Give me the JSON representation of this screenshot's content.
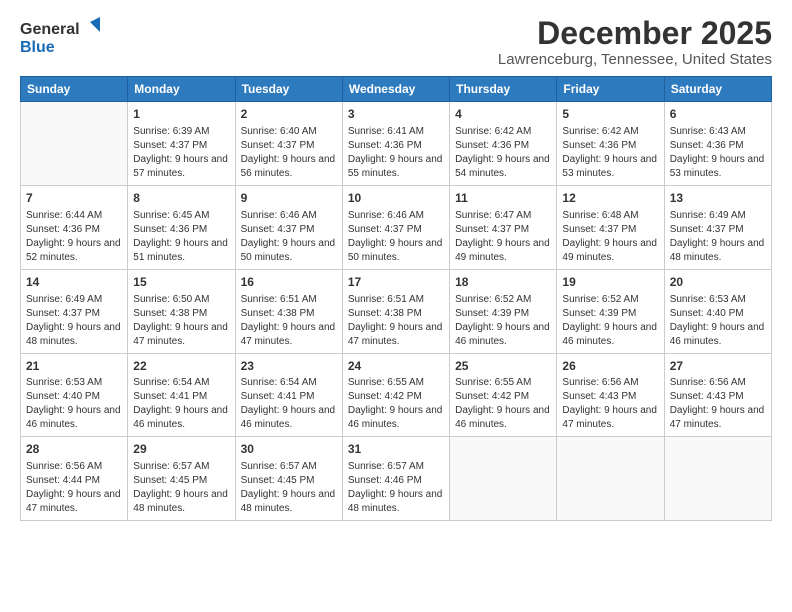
{
  "header": {
    "logo_general": "General",
    "logo_blue": "Blue",
    "month": "December 2025",
    "location": "Lawrenceburg, Tennessee, United States"
  },
  "weekdays": [
    "Sunday",
    "Monday",
    "Tuesday",
    "Wednesday",
    "Thursday",
    "Friday",
    "Saturday"
  ],
  "weeks": [
    [
      {
        "day": "",
        "sunrise": "",
        "sunset": "",
        "daylight": "",
        "empty": true
      },
      {
        "day": "1",
        "sunrise": "Sunrise: 6:39 AM",
        "sunset": "Sunset: 4:37 PM",
        "daylight": "Daylight: 9 hours and 57 minutes."
      },
      {
        "day": "2",
        "sunrise": "Sunrise: 6:40 AM",
        "sunset": "Sunset: 4:37 PM",
        "daylight": "Daylight: 9 hours and 56 minutes."
      },
      {
        "day": "3",
        "sunrise": "Sunrise: 6:41 AM",
        "sunset": "Sunset: 4:36 PM",
        "daylight": "Daylight: 9 hours and 55 minutes."
      },
      {
        "day": "4",
        "sunrise": "Sunrise: 6:42 AM",
        "sunset": "Sunset: 4:36 PM",
        "daylight": "Daylight: 9 hours and 54 minutes."
      },
      {
        "day": "5",
        "sunrise": "Sunrise: 6:42 AM",
        "sunset": "Sunset: 4:36 PM",
        "daylight": "Daylight: 9 hours and 53 minutes."
      },
      {
        "day": "6",
        "sunrise": "Sunrise: 6:43 AM",
        "sunset": "Sunset: 4:36 PM",
        "daylight": "Daylight: 9 hours and 53 minutes."
      }
    ],
    [
      {
        "day": "7",
        "sunrise": "Sunrise: 6:44 AM",
        "sunset": "Sunset: 4:36 PM",
        "daylight": "Daylight: 9 hours and 52 minutes."
      },
      {
        "day": "8",
        "sunrise": "Sunrise: 6:45 AM",
        "sunset": "Sunset: 4:36 PM",
        "daylight": "Daylight: 9 hours and 51 minutes."
      },
      {
        "day": "9",
        "sunrise": "Sunrise: 6:46 AM",
        "sunset": "Sunset: 4:37 PM",
        "daylight": "Daylight: 9 hours and 50 minutes."
      },
      {
        "day": "10",
        "sunrise": "Sunrise: 6:46 AM",
        "sunset": "Sunset: 4:37 PM",
        "daylight": "Daylight: 9 hours and 50 minutes."
      },
      {
        "day": "11",
        "sunrise": "Sunrise: 6:47 AM",
        "sunset": "Sunset: 4:37 PM",
        "daylight": "Daylight: 9 hours and 49 minutes."
      },
      {
        "day": "12",
        "sunrise": "Sunrise: 6:48 AM",
        "sunset": "Sunset: 4:37 PM",
        "daylight": "Daylight: 9 hours and 49 minutes."
      },
      {
        "day": "13",
        "sunrise": "Sunrise: 6:49 AM",
        "sunset": "Sunset: 4:37 PM",
        "daylight": "Daylight: 9 hours and 48 minutes."
      }
    ],
    [
      {
        "day": "14",
        "sunrise": "Sunrise: 6:49 AM",
        "sunset": "Sunset: 4:37 PM",
        "daylight": "Daylight: 9 hours and 48 minutes."
      },
      {
        "day": "15",
        "sunrise": "Sunrise: 6:50 AM",
        "sunset": "Sunset: 4:38 PM",
        "daylight": "Daylight: 9 hours and 47 minutes."
      },
      {
        "day": "16",
        "sunrise": "Sunrise: 6:51 AM",
        "sunset": "Sunset: 4:38 PM",
        "daylight": "Daylight: 9 hours and 47 minutes."
      },
      {
        "day": "17",
        "sunrise": "Sunrise: 6:51 AM",
        "sunset": "Sunset: 4:38 PM",
        "daylight": "Daylight: 9 hours and 47 minutes."
      },
      {
        "day": "18",
        "sunrise": "Sunrise: 6:52 AM",
        "sunset": "Sunset: 4:39 PM",
        "daylight": "Daylight: 9 hours and 46 minutes."
      },
      {
        "day": "19",
        "sunrise": "Sunrise: 6:52 AM",
        "sunset": "Sunset: 4:39 PM",
        "daylight": "Daylight: 9 hours and 46 minutes."
      },
      {
        "day": "20",
        "sunrise": "Sunrise: 6:53 AM",
        "sunset": "Sunset: 4:40 PM",
        "daylight": "Daylight: 9 hours and 46 minutes."
      }
    ],
    [
      {
        "day": "21",
        "sunrise": "Sunrise: 6:53 AM",
        "sunset": "Sunset: 4:40 PM",
        "daylight": "Daylight: 9 hours and 46 minutes."
      },
      {
        "day": "22",
        "sunrise": "Sunrise: 6:54 AM",
        "sunset": "Sunset: 4:41 PM",
        "daylight": "Daylight: 9 hours and 46 minutes."
      },
      {
        "day": "23",
        "sunrise": "Sunrise: 6:54 AM",
        "sunset": "Sunset: 4:41 PM",
        "daylight": "Daylight: 9 hours and 46 minutes."
      },
      {
        "day": "24",
        "sunrise": "Sunrise: 6:55 AM",
        "sunset": "Sunset: 4:42 PM",
        "daylight": "Daylight: 9 hours and 46 minutes."
      },
      {
        "day": "25",
        "sunrise": "Sunrise: 6:55 AM",
        "sunset": "Sunset: 4:42 PM",
        "daylight": "Daylight: 9 hours and 46 minutes."
      },
      {
        "day": "26",
        "sunrise": "Sunrise: 6:56 AM",
        "sunset": "Sunset: 4:43 PM",
        "daylight": "Daylight: 9 hours and 47 minutes."
      },
      {
        "day": "27",
        "sunrise": "Sunrise: 6:56 AM",
        "sunset": "Sunset: 4:43 PM",
        "daylight": "Daylight: 9 hours and 47 minutes."
      }
    ],
    [
      {
        "day": "28",
        "sunrise": "Sunrise: 6:56 AM",
        "sunset": "Sunset: 4:44 PM",
        "daylight": "Daylight: 9 hours and 47 minutes."
      },
      {
        "day": "29",
        "sunrise": "Sunrise: 6:57 AM",
        "sunset": "Sunset: 4:45 PM",
        "daylight": "Daylight: 9 hours and 48 minutes."
      },
      {
        "day": "30",
        "sunrise": "Sunrise: 6:57 AM",
        "sunset": "Sunset: 4:45 PM",
        "daylight": "Daylight: 9 hours and 48 minutes."
      },
      {
        "day": "31",
        "sunrise": "Sunrise: 6:57 AM",
        "sunset": "Sunset: 4:46 PM",
        "daylight": "Daylight: 9 hours and 48 minutes."
      },
      {
        "day": "",
        "sunrise": "",
        "sunset": "",
        "daylight": "",
        "empty": true
      },
      {
        "day": "",
        "sunrise": "",
        "sunset": "",
        "daylight": "",
        "empty": true
      },
      {
        "day": "",
        "sunrise": "",
        "sunset": "",
        "daylight": "",
        "empty": true
      }
    ]
  ]
}
